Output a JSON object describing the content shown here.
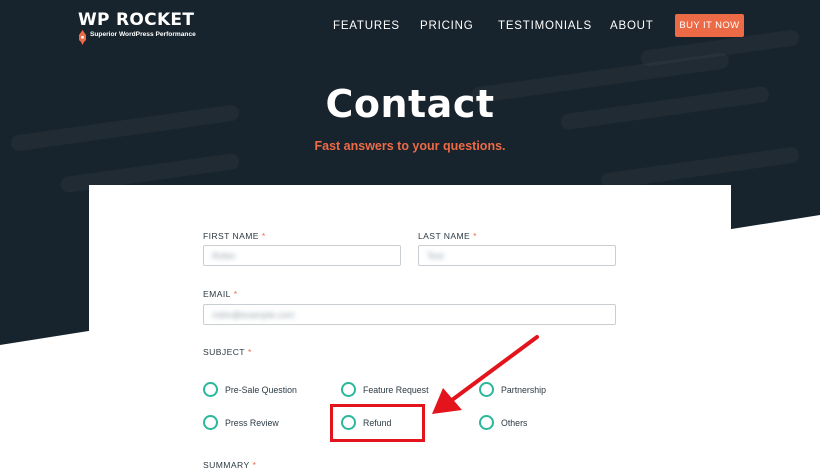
{
  "brand": {
    "name": "WP ROCKET",
    "tagline": "Superior WordPress Performance",
    "accent_color": "#ec6a45",
    "dark_bg": "#18242d",
    "radio_color": "#2bb89a"
  },
  "nav": {
    "items": [
      {
        "label": "FEATURES"
      },
      {
        "label": "PRICING"
      },
      {
        "label": "TESTIMONIALS"
      },
      {
        "label": "ABOUT"
      }
    ],
    "cta_label": "BUY IT NOW"
  },
  "hero": {
    "title": "Contact",
    "subtitle": "Fast answers to your questions."
  },
  "form": {
    "first_name": {
      "label": "FIRST NAME",
      "required_mark": "*",
      "value": "Robin"
    },
    "last_name": {
      "label": "LAST NAME",
      "required_mark": "*",
      "value": "Test"
    },
    "email": {
      "label": "EMAIL",
      "required_mark": "*",
      "value": "robin@example.com"
    },
    "subject": {
      "label": "SUBJECT",
      "required_mark": "*",
      "options": [
        {
          "label": "Pre-Sale Question"
        },
        {
          "label": "Feature Request"
        },
        {
          "label": "Partnership"
        },
        {
          "label": "Press Review"
        },
        {
          "label": "Refund"
        },
        {
          "label": "Others"
        }
      ]
    },
    "summary": {
      "label": "SUMMARY",
      "required_mark": "*"
    }
  },
  "annotation": {
    "highlighted_option": "Refund",
    "color": "#e3141b"
  }
}
